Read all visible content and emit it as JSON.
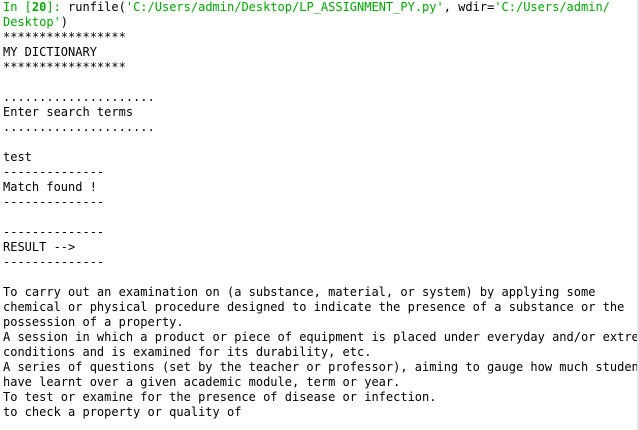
{
  "console": {
    "prompt": {
      "in_label": "In [",
      "number": "20",
      "close": "]: ",
      "call_open": "runfile(",
      "file_path": "'C:/Users/admin/Desktop/LP_ASSIGNMENT_PY.py'",
      "sep": ", wdir=",
      "wdir_part1": "'C:/Users/admin/",
      "wdir_part2": "Desktop'",
      "call_close": ")"
    },
    "lines": [
      "*****************",
      "MY DICTIONARY",
      "*****************",
      "",
      ".....................",
      "Enter search terms",
      ".....................",
      "",
      "test",
      "--------------",
      "Match found !",
      "--------------",
      "",
      "--------------",
      "RESULT -->",
      "--------------",
      "",
      "To carry out an examination on (a substance, material, or system) by applying some",
      "chemical or physical procedure designed to indicate the presence of a substance or the",
      "possession of a property.",
      "A session in which a product or piece of equipment is placed under everyday and/or extreme",
      "conditions and is examined for its durability, etc.",
      "A series of questions (set by the teacher or professor), aiming to gauge how much students",
      "have learnt over a given academic module, term or year.",
      "To test or examine for the presence of disease or infection.",
      "to check a property or quality of"
    ]
  }
}
